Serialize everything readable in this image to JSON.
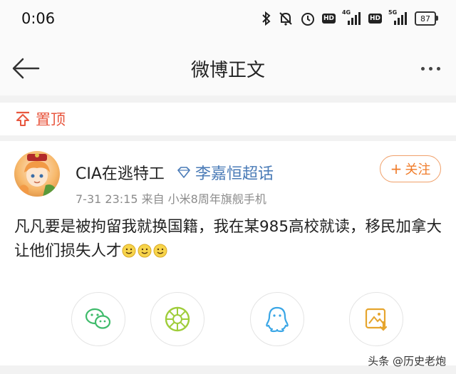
{
  "status_bar": {
    "time": "0:06",
    "hd_label_1": "HD",
    "net_1": "4G",
    "hd_label_2": "HD",
    "net_2": "5G",
    "battery": "87",
    "icons": [
      "bluetooth-icon",
      "mute-icon",
      "alarm-icon",
      "hd-badge",
      "signal-4g-icon",
      "hd-badge",
      "signal-5g-icon",
      "battery-icon"
    ]
  },
  "nav": {
    "title": "微博正文",
    "back_icon": "back-arrow-icon",
    "more_icon": "more-dots-icon"
  },
  "pinned": {
    "label": "置顶",
    "icon": "pin-top-icon",
    "color": "#e8573f"
  },
  "post": {
    "author": "CIA在逃特工",
    "topic": "李嘉恒超话",
    "follow_label": "关注",
    "meta": "7-31 23:15  来自 小米8周年旗舰手机",
    "text": "凡凡要是被拘留我就换国籍，我在某985高校就读，移民加拿大让他们损失人才",
    "emoji_count": 3,
    "link_color": "#4a7bb7",
    "accent_color": "#f07c2a"
  },
  "share": {
    "items": [
      "wechat-icon",
      "moments-icon",
      "qq-icon",
      "save-image-icon"
    ]
  },
  "watermark": "头条 @历史老炮"
}
